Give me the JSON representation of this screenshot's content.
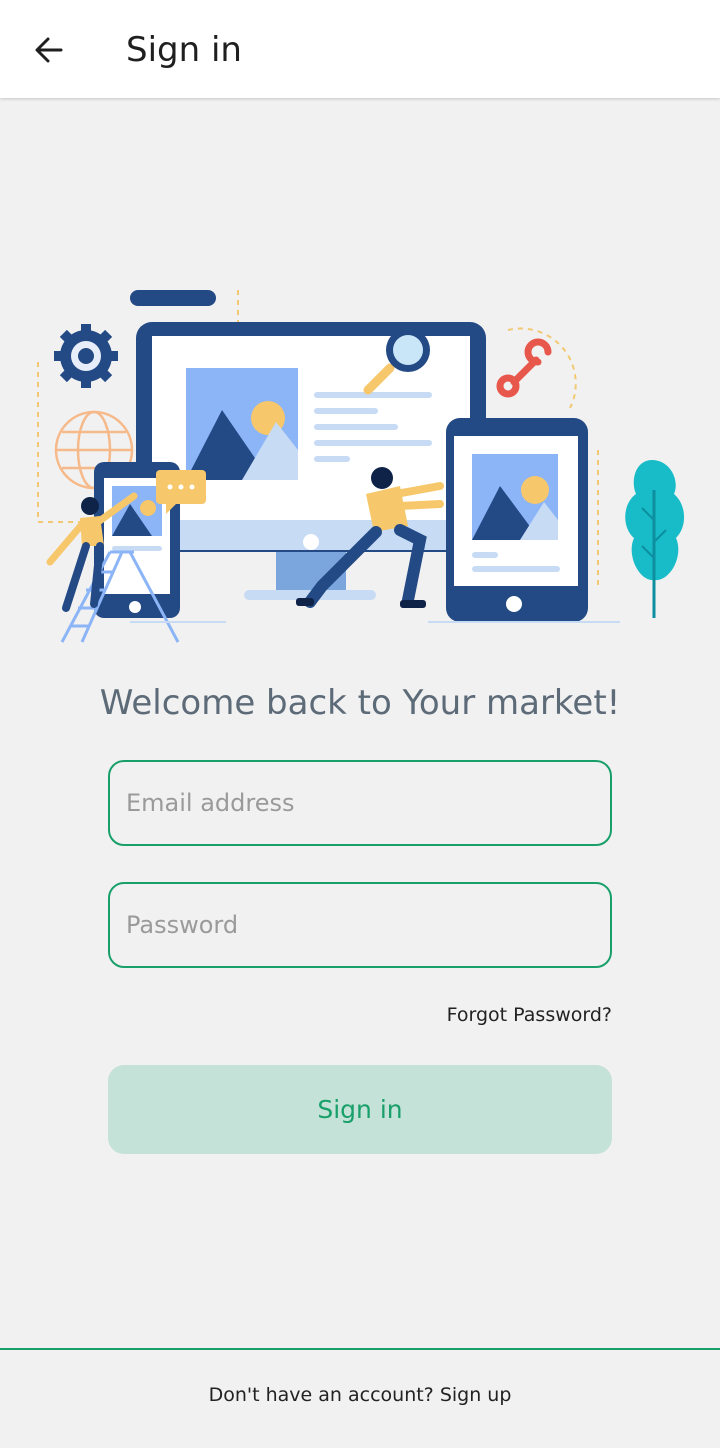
{
  "header": {
    "title": "Sign in",
    "back_icon": "arrow-left-icon"
  },
  "illustration": {
    "name": "responsive-devices-illustration"
  },
  "welcome": "Welcome back to Your market!",
  "form": {
    "email_placeholder": "Email address",
    "email_value": "",
    "password_placeholder": "Password",
    "password_value": "",
    "forgot_label": "Forgot Password?",
    "submit_label": "Sign in"
  },
  "footer": {
    "prompt": "Don't have an account?",
    "link": "Sign up"
  },
  "colors": {
    "accent": "#19a06a",
    "button_bg": "#c5e2d8",
    "navy": "#234a85",
    "yellow": "#f7c76b",
    "teal": "#17bcc8"
  }
}
